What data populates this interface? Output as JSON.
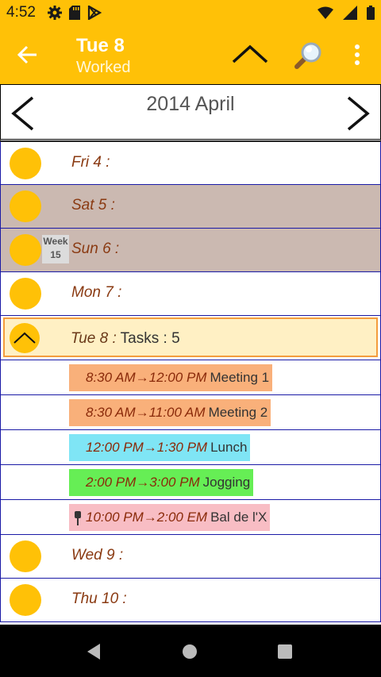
{
  "status_bar": {
    "time": "4:52",
    "left_icons": [
      "gear-icon",
      "sd-card-icon",
      "play-store-icon"
    ],
    "right_icons": [
      "wifi-icon",
      "signal-icon",
      "battery-icon"
    ]
  },
  "app_bar": {
    "title": "Tue 8",
    "subtitle": "Worked",
    "accent_color": "#FFC107"
  },
  "month_nav": {
    "title": "2014 April"
  },
  "days": [
    {
      "label": "Fri 4 :",
      "weekend": false
    },
    {
      "label": "Sat 5 :",
      "weekend": true
    },
    {
      "label": "Sun 6 :",
      "weekend": true,
      "week_label": "Week",
      "week_number": "15"
    },
    {
      "label": "Mon 7 :",
      "weekend": false
    }
  ],
  "selected_day": {
    "label": "Tue 8 :",
    "tasks_text": "Tasks : 5"
  },
  "tasks": [
    {
      "time": "8:30 AM→12:00 PM",
      "name": "Meeting 1",
      "color": "#F9B07A"
    },
    {
      "time": "8:30 AM→11:00 AM",
      "name": "Meeting 2",
      "color": "#F9B07A"
    },
    {
      "time": "12:00 PM→1:30 PM",
      "name": "Lunch",
      "color": "#7FE5F5"
    },
    {
      "time": "2:00 PM→3:00 PM",
      "name": "Jogging",
      "color": "#66EE55"
    },
    {
      "time": "10:00 PM→2:00 EM",
      "name": "Bal de l'X",
      "color": "#F8BDC4",
      "pinned": true
    }
  ],
  "later_days": [
    {
      "label": "Wed 9 :"
    },
    {
      "label": "Thu 10 :"
    }
  ]
}
